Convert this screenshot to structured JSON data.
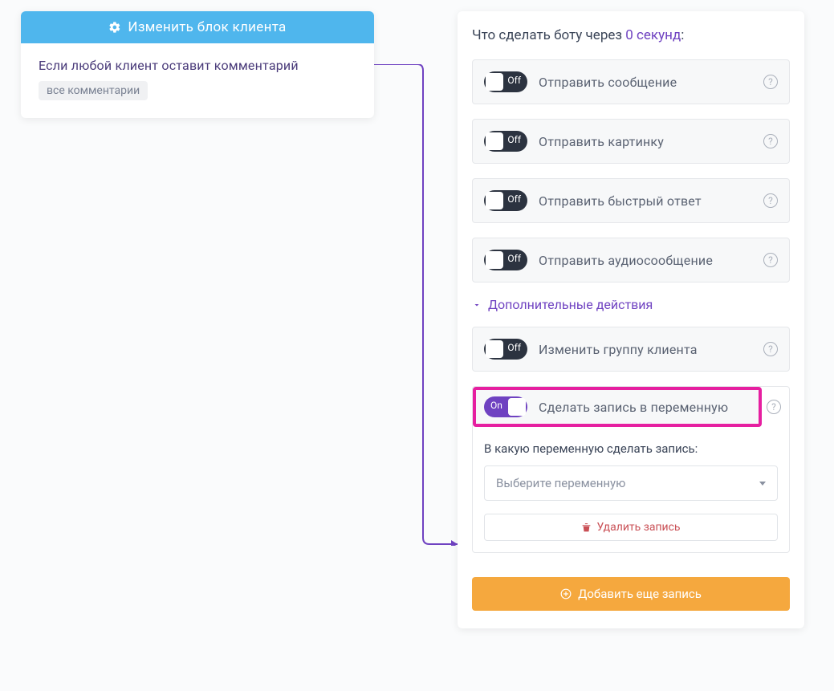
{
  "left": {
    "header": "Изменить блок клиента",
    "condition": "Если любой клиент оставит комментарий",
    "chip": "все комментарии"
  },
  "right": {
    "title_prefix": "Что сделать боту через ",
    "seconds": "0 секунд",
    "title_suffix": ":",
    "toggle_off": "Off",
    "toggle_on": "On",
    "actions": {
      "send_message": "Отправить сообщение",
      "send_image": "Отправить картинку",
      "send_quick_reply": "Отправить быстрый ответ",
      "send_audio": "Отправить аудиосообщение"
    },
    "additional_header": "Дополнительные действия",
    "change_group": "Изменить группу клиента",
    "write_variable": "Сделать запись в переменную",
    "variable_section": {
      "label": "В какую переменную сделать запись:",
      "select_placeholder": "Выберите переменную",
      "delete": "Удалить запись"
    },
    "add_button": "Добавить еще запись"
  }
}
